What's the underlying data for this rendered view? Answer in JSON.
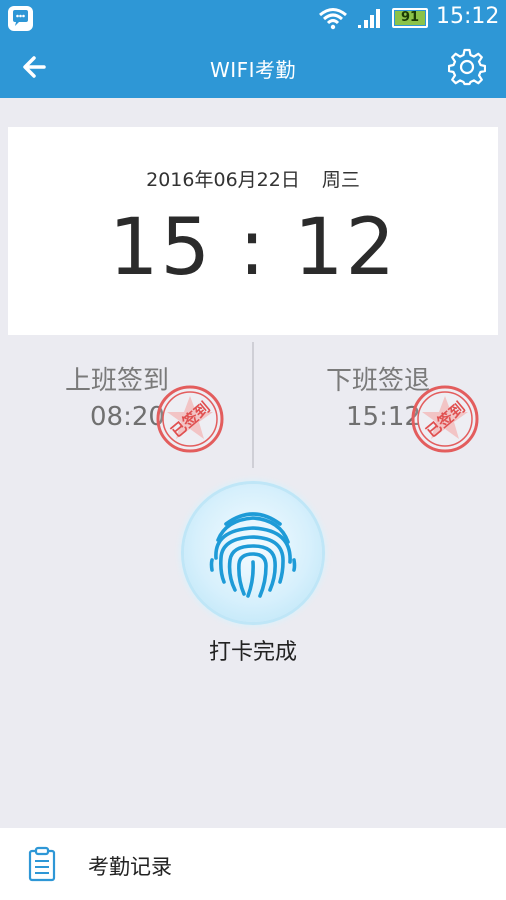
{
  "status_bar": {
    "time": "15:12",
    "battery": "91",
    "icons": [
      "chat-app-icon",
      "wifi-icon",
      "signal-icon",
      "battery-icon"
    ]
  },
  "app_bar": {
    "title": "WIFI考勤",
    "back_icon": "arrow-left-icon",
    "settings_icon": "gear-icon"
  },
  "time_card": {
    "date": "2016年06月22日",
    "weekday": "周三",
    "clock": "15 : 12"
  },
  "checks": {
    "check_in": {
      "title": "上班签到",
      "time": "08:20",
      "stamp": "已签到"
    },
    "check_out": {
      "title": "下班签退",
      "time": "15:12",
      "stamp": "已签到"
    }
  },
  "fingerprint": {
    "icon": "fingerprint-icon",
    "label": "打卡完成"
  },
  "bottom_bar": {
    "icon": "clipboard-icon",
    "label": "考勤记录"
  },
  "colors": {
    "header": "#2e97d6",
    "background": "#ebebf1",
    "stamp": "#e05050",
    "fingerprint": "#1e9bd7"
  }
}
